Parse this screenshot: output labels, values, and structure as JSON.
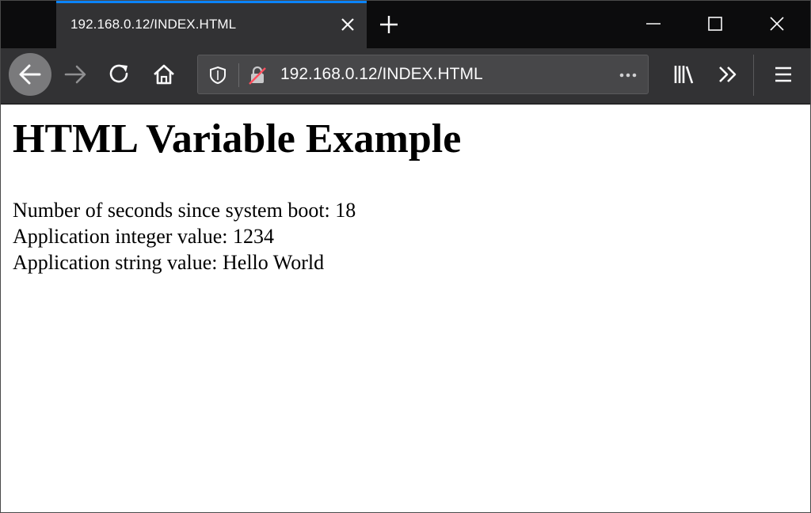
{
  "browser": {
    "tab": {
      "title": "192.168.0.12/INDEX.HTML"
    },
    "url": "192.168.0.12/INDEX.HTML",
    "accent_color": "#0a84ff",
    "icons": [
      "close-icon",
      "plus-icon",
      "minimize-icon",
      "maximize-icon",
      "close-window-icon",
      "arrow-left-icon",
      "arrow-right-icon",
      "reload-icon",
      "home-icon",
      "shield-icon",
      "insecure-lock-icon",
      "more-dots-icon",
      "library-icon",
      "chevron-double-right-icon",
      "hamburger-menu-icon"
    ]
  },
  "page": {
    "heading": "HTML Variable Example",
    "lines": [
      {
        "label": "Number of seconds since system boot:",
        "value": "18"
      },
      {
        "label": "Application integer value:",
        "value": "1234"
      },
      {
        "label": "Application string value:",
        "value": "Hello World"
      }
    ]
  }
}
